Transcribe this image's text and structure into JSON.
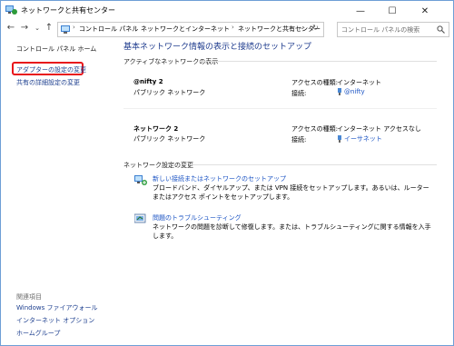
{
  "window": {
    "title": "ネットワークと共有センター",
    "minimize": "—",
    "maximize": "☐",
    "close": "✕"
  },
  "address": {
    "back": "←",
    "forward": "→",
    "up": "↑",
    "breadcrumbs": [
      "コントロール パネル",
      "ネットワークとインターネット",
      "ネットワークと共有センター"
    ],
    "refresh": "↻",
    "dropdown": "⌄",
    "search_placeholder": "コントロール パネルの検索"
  },
  "sidebar": {
    "home": "コントロール パネル ホーム",
    "items": [
      "アダプターの設定の変更",
      "共有の詳細設定の変更"
    ],
    "related_title": "関連項目",
    "related_items": [
      "Windows ファイアウォール",
      "インターネット オプション",
      "ホームグループ"
    ]
  },
  "main": {
    "title": "基本ネットワーク情報の表示と接続のセットアップ",
    "active_networks_label": "アクティブなネットワークの表示",
    "networks": [
      {
        "name": "@nifty 2",
        "type": "パブリック ネットワーク",
        "access_label": "アクセスの種類:",
        "access_value": "インターネット",
        "connection_label": "接続:",
        "connection_value": "@nifty"
      },
      {
        "name": "ネットワーク 2",
        "type": "パブリック ネットワーク",
        "access_label": "アクセスの種類:",
        "access_value": "インターネット アクセスなし",
        "connection_label": "接続:",
        "connection_value": "イーサネット"
      }
    ],
    "settings_label": "ネットワーク設定の変更",
    "tasks": [
      {
        "link": "新しい接続またはネットワークのセットアップ",
        "description": "ブロードバンド、ダイヤルアップ、または VPN 接続をセットアップします。あるいは、ルーターまたはアクセス ポイントをセットアップします。"
      },
      {
        "link": "問題のトラブルシューティング",
        "description": "ネットワークの問題を診断して修復します。または、トラブルシューティングに関する情報を入手します。"
      }
    ]
  },
  "colors": {
    "accent": "#1d55c4",
    "highlight_box": "#e8151b",
    "title_blue": "#1f3c8e"
  }
}
